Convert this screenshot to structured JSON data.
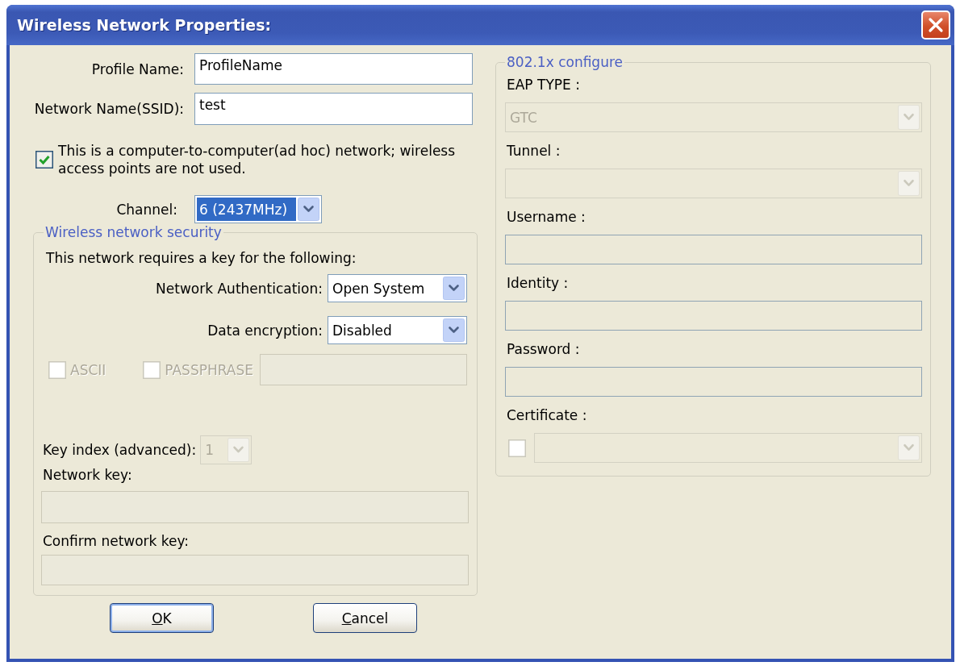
{
  "window": {
    "title": "Wireless Network Properties:"
  },
  "general": {
    "fields": [
      {
        "label": "Profile Name:",
        "value": "ProfileName"
      },
      {
        "label": "Network Name(SSID):",
        "value": "test"
      }
    ],
    "adhoc": {
      "label": "This is a computer-to-computer(ad hoc) network; wireless access points are not used.",
      "checked": true
    },
    "channel": {
      "label": "Channel:",
      "value": "6 (2437MHz)",
      "highlighted": true
    }
  },
  "security": {
    "title": "Wireless network security",
    "intro": "This network requires a key for the following:",
    "selects": [
      {
        "label": "Network Authentication:",
        "value": "Open System",
        "disabled": false
      },
      {
        "label": "Data encryption:",
        "value": "Disabled",
        "disabled": false
      }
    ],
    "key_options": [
      {
        "label": "ASCII",
        "checked": false,
        "disabled": true
      },
      {
        "label": "PASSPHRASE",
        "checked": false,
        "disabled": true
      }
    ],
    "passphrase": {
      "disabled": true
    },
    "key_index": {
      "label": "Key index (advanced):",
      "value": "1",
      "disabled": true
    },
    "keys": [
      {
        "label": "Network key:",
        "disabled": true
      },
      {
        "label": "Confirm network key:",
        "disabled": true
      }
    ]
  },
  "eap": {
    "title": "802.1x configure",
    "items": [
      {
        "kind": "select",
        "label": "EAP TYPE :",
        "value": "GTC",
        "disabled": true
      },
      {
        "kind": "select",
        "label": "Tunnel :",
        "disabled": true
      },
      {
        "kind": "input",
        "label": "Username :",
        "disabled": true
      },
      {
        "kind": "input",
        "label": "Identity :",
        "disabled": true
      },
      {
        "kind": "input",
        "label": "Password :",
        "disabled": true
      },
      {
        "kind": "certificate",
        "label": "Certificate :",
        "checked": false,
        "disabled": true
      }
    ]
  },
  "buttons": [
    {
      "label": "OK",
      "first_letter_underlined": true,
      "default": true
    },
    {
      "label": "Cancel",
      "first_letter_underlined": true,
      "default": false
    }
  ]
}
